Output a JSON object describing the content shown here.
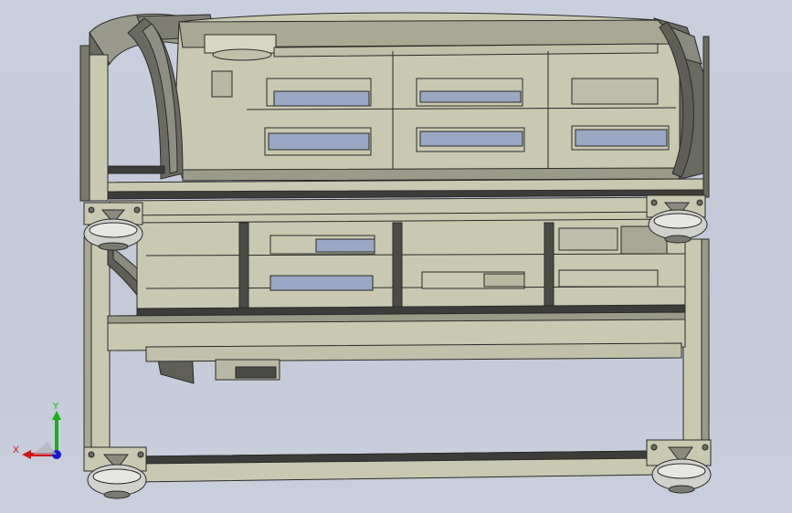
{
  "viewport": {
    "background_top": "#c9cfdd",
    "background_bottom": "#c9cfdb"
  },
  "model": {
    "frame_color": "#c9c9b2",
    "frame_shadow": "#8f8f7c",
    "edge_color": "#2a2a28",
    "dark_band": "#3c3c3a",
    "window_color": "#9aa8c4",
    "caster_color": "#d0d0cc",
    "drag_chain_color": "#6a6a62"
  },
  "triad": {
    "x_label": "X",
    "y_label": "Y",
    "x_color": "#d01818",
    "y_color": "#18b018",
    "z_color": "#1818d0"
  }
}
